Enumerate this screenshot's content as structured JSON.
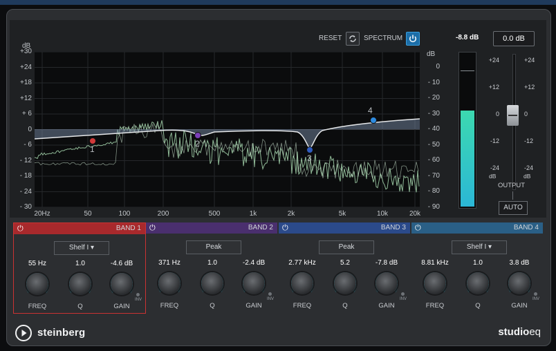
{
  "header": {
    "reset_label": "RESET",
    "spectrum_label": "SPECTRUM",
    "peak_readout": "-8.8 dB",
    "output_value": "0.0 dB"
  },
  "graph": {
    "left_axis_unit": "dB",
    "right_axis_unit": "dB",
    "left_ticks": [
      "+30",
      "+24",
      "+18",
      "+12",
      "+ 6",
      "0",
      "- 6",
      "- 12",
      "- 18",
      "- 24",
      "- 30"
    ],
    "right_ticks": [
      "0",
      "- 10",
      "- 20",
      "- 30",
      "- 40",
      "- 50",
      "- 60",
      "- 70",
      "- 80",
      "- 90"
    ],
    "freq_ticks": [
      "20Hz",
      "50",
      "100",
      "200",
      "500",
      "1k",
      "2k",
      "5k",
      "10k",
      "20k"
    ],
    "nodes": [
      "1",
      "2",
      "3",
      "4"
    ],
    "node_colors": [
      "#d23a3a",
      "#7b3fb8",
      "#2f5cc0",
      "#2d8be0"
    ]
  },
  "output": {
    "ticks_left": [
      "+24",
      "+12",
      "0",
      "-12",
      "-24"
    ],
    "ticks_right": [
      "+24",
      "+12",
      "0",
      "-12",
      "-24"
    ],
    "db_label": "dB",
    "label": "OUTPUT",
    "auto_label": "AUTO",
    "meter_level": 0.63
  },
  "bands": [
    {
      "title": "BAND 1",
      "type": "Shelf I",
      "freq": "55 Hz",
      "q": "1.0",
      "gain": "-4.6 dB",
      "freq_label": "FREQ",
      "q_label": "Q",
      "gain_label": "GAIN",
      "inv": "INV",
      "color": "#a8292c"
    },
    {
      "title": "BAND 2",
      "type": "Peak",
      "freq": "371 Hz",
      "q": "1.0",
      "gain": "-2.4 dB",
      "freq_label": "FREQ",
      "q_label": "Q",
      "gain_label": "GAIN",
      "inv": "INV",
      "color": "#4a2f6e"
    },
    {
      "title": "BAND 3",
      "type": "Peak",
      "freq": "2.77 kHz",
      "q": "5.2",
      "gain": "-7.8 dB",
      "freq_label": "FREQ",
      "q_label": "Q",
      "gain_label": "GAIN",
      "inv": "INV",
      "color": "#2b4a8a"
    },
    {
      "title": "BAND 4",
      "type": "Shelf I",
      "freq": "8.81 kHz",
      "q": "1.0",
      "gain": "3.8 dB",
      "freq_label": "FREQ",
      "q_label": "Q",
      "gain_label": "GAIN",
      "inv": "INV",
      "color": "#2a5f86"
    }
  ],
  "footer": {
    "brand": "steinberg",
    "product_main": "studio",
    "product_suffix": "eq"
  },
  "colors": {
    "accent_cyan": "#2bc4e0",
    "meter_green": "#3cd9b0"
  }
}
